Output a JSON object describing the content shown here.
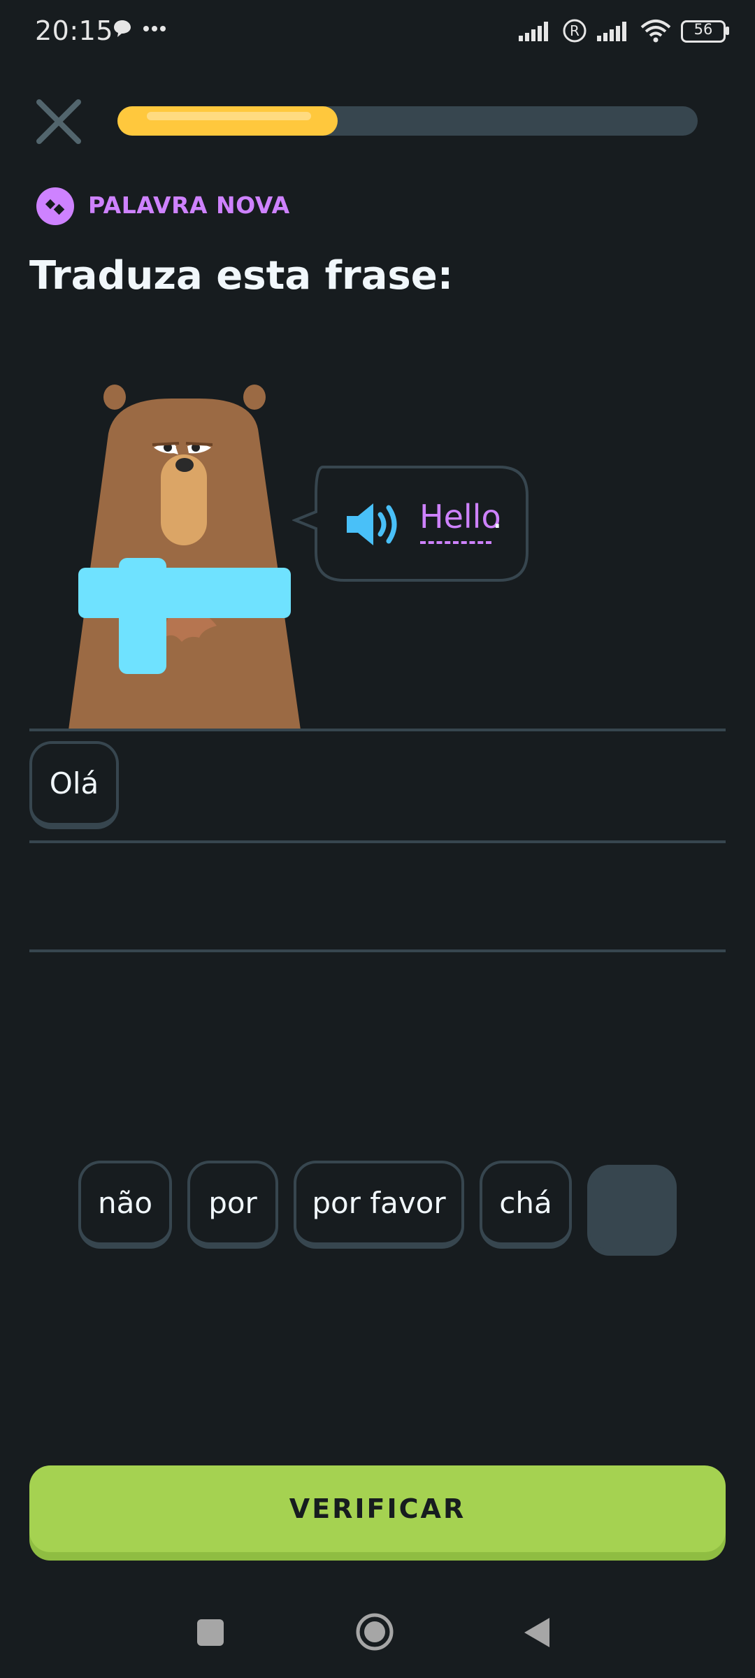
{
  "status": {
    "time": "20:15",
    "battery": "56"
  },
  "icons": {
    "close": "close-icon",
    "new_word": "new-word-icon",
    "speaker": "speaker-icon",
    "chat": "chat-bubble-icon",
    "more": "more-dots-icon",
    "signal": "signal-icon",
    "registered": "registered-icon",
    "wifi": "wifi-icon",
    "battery": "battery-icon"
  },
  "lesson": {
    "progress": 0.38,
    "badge_label": "PALAVRA NOVA",
    "title": "Traduza esta frase:"
  },
  "prompt": {
    "word": "Hello",
    "punctuation": "."
  },
  "answer": {
    "selected": [
      "Olá"
    ]
  },
  "word_bank": [
    "não",
    "por",
    "por favor",
    "chá"
  ],
  "actions": {
    "verify_label": "VERIFICAR"
  },
  "colors": {
    "background": "#171c1f",
    "accent_purple": "#ce82ff",
    "progress": "#ffc83d",
    "button_green": "#a5d251",
    "border": "#37464f"
  }
}
